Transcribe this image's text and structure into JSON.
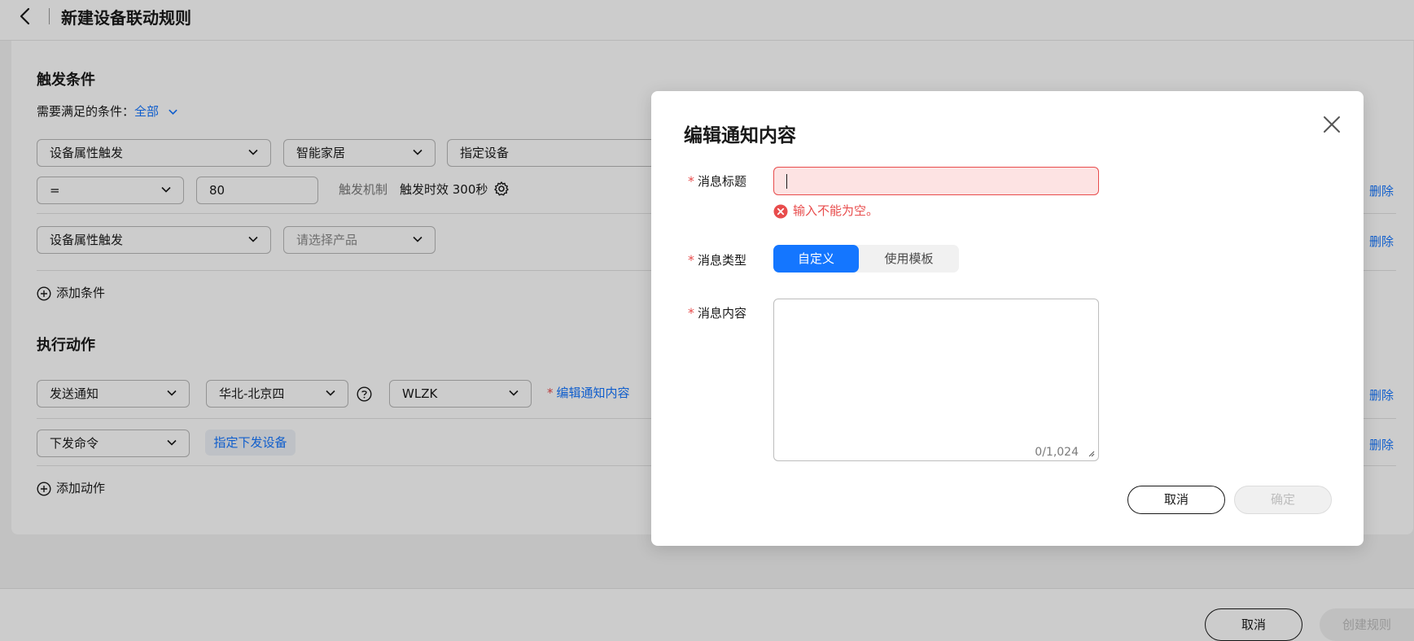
{
  "header": {
    "title": "新建设备联动规则"
  },
  "trigger": {
    "section_title": "触发条件",
    "condition_prefix": "需要满足的条件：",
    "condition_value": "全部",
    "row1": {
      "type": "设备属性触发",
      "product": "智能家居",
      "device": "指定设备"
    },
    "row1b": {
      "operator": "=",
      "value": "80",
      "mechanism_label": "触发机制",
      "mechanism_value": "触发时效 300秒",
      "delete": "删除"
    },
    "row2": {
      "type": "设备属性触发",
      "product_placeholder": "请选择产品",
      "delete": "删除"
    },
    "add_condition": "添加条件"
  },
  "action": {
    "section_title": "执行动作",
    "row1": {
      "type": "发送通知",
      "region": "华北-北京四",
      "topic": "WLZK",
      "edit_star": "*",
      "edit_link": "编辑通知内容",
      "delete": "删除"
    },
    "row2": {
      "type": "下发命令",
      "device_link": "指定下发设备",
      "delete": "删除"
    },
    "add_action": "添加动作"
  },
  "footer": {
    "cancel": "取消",
    "create": "创建规则"
  },
  "dialog": {
    "title": "编辑通知内容",
    "msg_title_label": "消息标题",
    "msg_title_value": "",
    "msg_title_error": "输入不能为空。",
    "msg_type_label": "消息类型",
    "msg_type_options": [
      "自定义",
      "使用模板"
    ],
    "msg_type_selected": "自定义",
    "msg_content_label": "消息内容",
    "msg_content_value": "",
    "msg_content_counter": "0/1,024",
    "cancel": "取消",
    "confirm": "确定"
  },
  "colors": {
    "accent": "#1476ff",
    "error": "#e84c4c",
    "disabled_bg": "#f0f0f0",
    "disabled_text": "#bdbdbd"
  }
}
